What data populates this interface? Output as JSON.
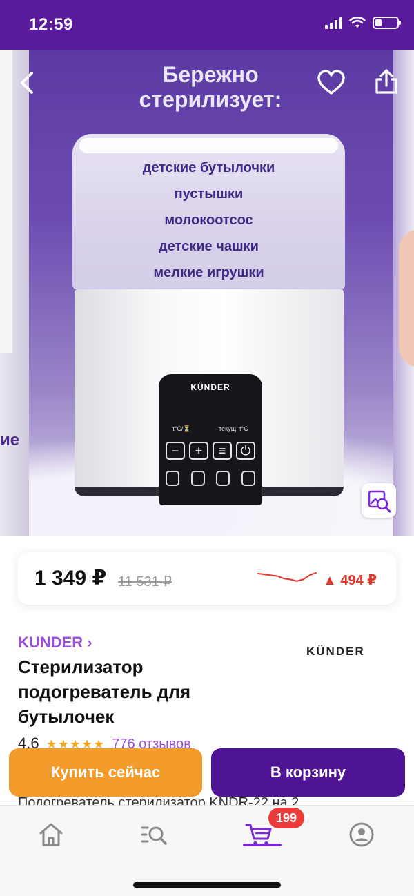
{
  "status_bar": {
    "time": "12:59"
  },
  "hero": {
    "title_line1": "Бережно",
    "title_line2": "стерилизует:",
    "items": [
      "детские бутылочки",
      "пустышки",
      "молокоотсос",
      "детские чашки",
      "мелкие игрушки"
    ],
    "device_brand": "KÜNDER",
    "panel_label_left": "t°C/⏳",
    "panel_label_right": "текущ. t°C",
    "side_text": "ие"
  },
  "price": {
    "current": "1 349 ₽",
    "old": "11 531 ₽",
    "delta": "▲ 494 ₽",
    "trend": [
      0.25,
      0.3,
      0.35,
      0.4,
      0.55,
      0.6,
      0.7,
      0.6,
      0.35,
      0.2
    ],
    "trend_color": "#e0382a"
  },
  "product": {
    "brand_link": "KUNDER ›",
    "brand_logo": "KÜNDER",
    "title": "Стерилизатор подогреватель для бутылочек",
    "rating": "4.6",
    "stars": "★★★★★",
    "reviews": "776 отзывов",
    "description_peek": "Подогреватель стерилизатор KNDR-22 на 2"
  },
  "actions": {
    "buy_now": "Купить сейчас",
    "add_to_cart": "В корзину"
  },
  "bottom_nav": {
    "cart_badge": "199",
    "items": [
      "home-icon",
      "catalog-search-icon",
      "cart-icon",
      "profile-icon"
    ]
  },
  "colors": {
    "brand_purple": "#5a1a9c",
    "cart_button": "#4f1396",
    "buy_button": "#f39b2b",
    "link_purple": "#9b4fd6",
    "badge_red": "#ec3b3b"
  }
}
